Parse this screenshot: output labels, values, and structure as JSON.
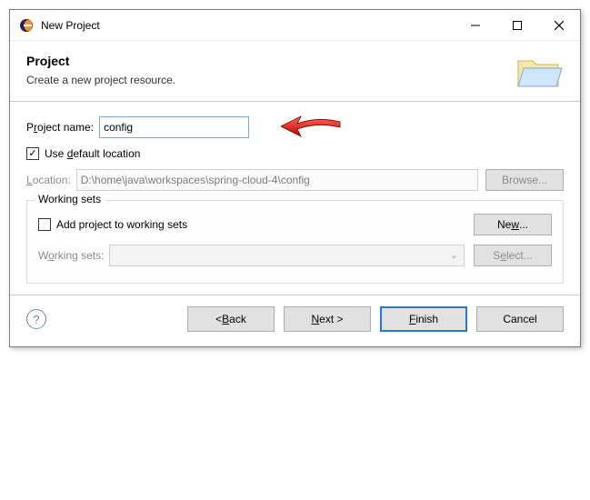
{
  "titlebar": {
    "title": "New Project"
  },
  "header": {
    "heading": "Project",
    "subheading": "Create a new project resource."
  },
  "project_name": {
    "label_pre": "P",
    "label_u": "r",
    "label_post": "oject name:",
    "value": "config"
  },
  "use_default": {
    "checked": true,
    "label_pre": "Use ",
    "label_u": "d",
    "label_post": "efault location"
  },
  "location": {
    "label_pre": "",
    "label_u": "L",
    "label_post": "ocation:",
    "value": "D:\\home\\java\\workspaces\\spring-cloud-4\\config",
    "browse_label": "Browse..."
  },
  "working_sets": {
    "group_title": "Working sets",
    "add_checked": false,
    "add_label": "Add project to working sets",
    "new_label_pre": "Ne",
    "new_label_u": "w",
    "new_label_post": "...",
    "row_label_pre": "W",
    "row_label_u": "o",
    "row_label_post": "rking sets:",
    "select_label_pre": "S",
    "select_label_u": "e",
    "select_label_post": "lect..."
  },
  "footer": {
    "back_pre": "< ",
    "back_u": "B",
    "back_post": "ack",
    "next_pre": "",
    "next_u": "N",
    "next_post": "ext >",
    "finish_pre": "",
    "finish_u": "F",
    "finish_post": "inish",
    "cancel": "Cancel"
  }
}
